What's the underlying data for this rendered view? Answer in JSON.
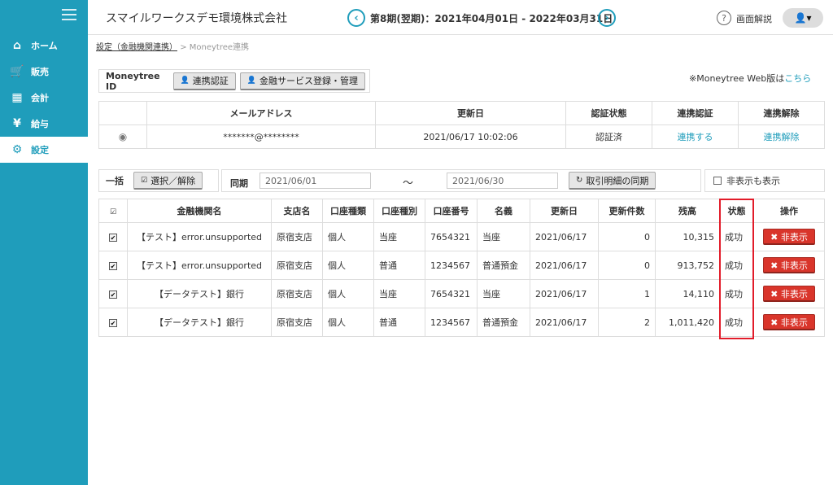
{
  "sidebar": {
    "items": [
      {
        "label": "ホーム",
        "icon": "home-icon",
        "glyph": "⌂"
      },
      {
        "label": "販売",
        "icon": "cart-icon",
        "glyph": "🛒"
      },
      {
        "label": "会計",
        "icon": "calculator-icon",
        "glyph": "▦"
      },
      {
        "label": "給与",
        "icon": "money-bag-icon",
        "glyph": "¥"
      },
      {
        "label": "設定",
        "icon": "gear-icon",
        "glyph": "⚙"
      }
    ]
  },
  "header": {
    "company": "スマイルワークスデモ環境株式会社",
    "period": "第8期(翌期)：2021年04月01日 - 2022年03月31日",
    "prev_glyph": "‹",
    "next_glyph": "›",
    "help_glyph": "?",
    "help_label": "画面解説",
    "user_glyph": "👤▾"
  },
  "breadcrumb": {
    "parent": "設定（金融機関連携）",
    "sep": ">",
    "current": "Moneytree連携"
  },
  "moneytree": {
    "label": "Moneytree ID",
    "btn_link": "連携認証",
    "btn_manage": "金融サービス登録・管理",
    "web_prefix": "※Moneytree Web版は",
    "web_link": "こちら"
  },
  "account_table": {
    "headers": [
      "メールアドレス",
      "更新日",
      "認証状態",
      "連携認証",
      "連携解除"
    ],
    "row": {
      "radio": "◉",
      "email": "*******@********",
      "updated": "2021/06/17 10:02:06",
      "status": "認証済",
      "link_action": "連携する",
      "unlink_action": "連携解除"
    }
  },
  "filter": {
    "bulk_label": "一括",
    "select_btn": "選択／解除",
    "sync_label": "同期",
    "date_from": "2021/06/01",
    "tilde": "〜",
    "date_to": "2021/06/30",
    "sync_btn": "取引明細の同期",
    "show_hidden": "非表示も表示"
  },
  "bank_table": {
    "headers": [
      "金融機関名",
      "支店名",
      "口座種類",
      "口座種別",
      "口座番号",
      "名義",
      "更新日",
      "更新件数",
      "残高",
      "状態",
      "操作"
    ],
    "hide_btn": "✖ 非表示",
    "rows": [
      {
        "bank": "【テスト】error.unsupported",
        "branch": "原宿支店",
        "kind": "個人",
        "type": "当座",
        "number": "7654321",
        "holder": "当座",
        "updated": "2021/06/17",
        "count": "0",
        "balance": "10,315",
        "status": "成功"
      },
      {
        "bank": "【テスト】error.unsupported",
        "branch": "原宿支店",
        "kind": "個人",
        "type": "普通",
        "number": "1234567",
        "holder": "普通預金",
        "updated": "2021/06/17",
        "count": "0",
        "balance": "913,752",
        "status": "成功"
      },
      {
        "bank": "【データテスト】銀行",
        "branch": "原宿支店",
        "kind": "個人",
        "type": "当座",
        "number": "7654321",
        "holder": "当座",
        "updated": "2021/06/17",
        "count": "1",
        "balance": "14,110",
        "status": "成功"
      },
      {
        "bank": "【データテスト】銀行",
        "branch": "原宿支店",
        "kind": "個人",
        "type": "普通",
        "number": "1234567",
        "holder": "普通預金",
        "updated": "2021/06/17",
        "count": "2",
        "balance": "1,011,420",
        "status": "成功"
      }
    ]
  },
  "colors": {
    "accent": "#1f9dbb",
    "danger": "#d9352b",
    "highlight": "#e21c2a"
  }
}
